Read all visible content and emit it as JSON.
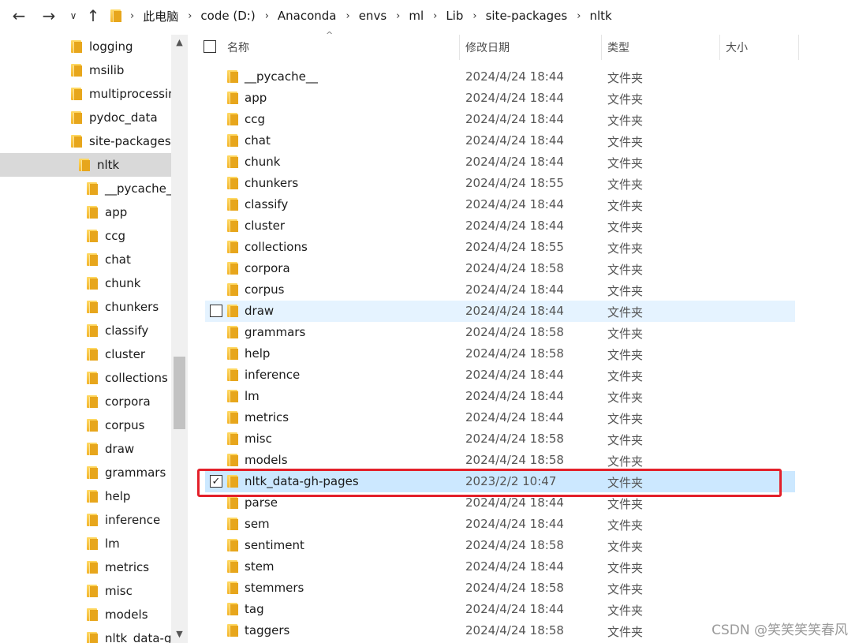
{
  "addressbar": {
    "path": [
      "此电脑",
      "code (D:)",
      "Anaconda",
      "envs",
      "ml",
      "Lib",
      "site-packages",
      "nltk"
    ]
  },
  "nav_tree": {
    "items": [
      {
        "label": "logging"
      },
      {
        "label": "msilib"
      },
      {
        "label": "multiprocessing"
      },
      {
        "label": "pydoc_data"
      },
      {
        "label": "site-packages"
      },
      {
        "label": "nltk"
      },
      {
        "label": "__pycache__"
      },
      {
        "label": "app"
      },
      {
        "label": "ccg"
      },
      {
        "label": "chat"
      },
      {
        "label": "chunk"
      },
      {
        "label": "chunkers"
      },
      {
        "label": "classify"
      },
      {
        "label": "cluster"
      },
      {
        "label": "collections"
      },
      {
        "label": "corpora"
      },
      {
        "label": "corpus"
      },
      {
        "label": "draw"
      },
      {
        "label": "grammars"
      },
      {
        "label": "help"
      },
      {
        "label": "inference"
      },
      {
        "label": "lm"
      },
      {
        "label": "metrics"
      },
      {
        "label": "misc"
      },
      {
        "label": "models"
      },
      {
        "label": "nltk_data-gh-pages"
      }
    ]
  },
  "columns": {
    "name": "名称",
    "date": "修改日期",
    "type": "类型",
    "size": "大小"
  },
  "files": [
    {
      "name": "__pycache__",
      "date": "2024/4/24 18:44",
      "type": "文件夹"
    },
    {
      "name": "app",
      "date": "2024/4/24 18:44",
      "type": "文件夹"
    },
    {
      "name": "ccg",
      "date": "2024/4/24 18:44",
      "type": "文件夹"
    },
    {
      "name": "chat",
      "date": "2024/4/24 18:44",
      "type": "文件夹"
    },
    {
      "name": "chunk",
      "date": "2024/4/24 18:44",
      "type": "文件夹"
    },
    {
      "name": "chunkers",
      "date": "2024/4/24 18:55",
      "type": "文件夹"
    },
    {
      "name": "classify",
      "date": "2024/4/24 18:44",
      "type": "文件夹"
    },
    {
      "name": "cluster",
      "date": "2024/4/24 18:44",
      "type": "文件夹"
    },
    {
      "name": "collections",
      "date": "2024/4/24 18:55",
      "type": "文件夹"
    },
    {
      "name": "corpora",
      "date": "2024/4/24 18:58",
      "type": "文件夹"
    },
    {
      "name": "corpus",
      "date": "2024/4/24 18:44",
      "type": "文件夹"
    },
    {
      "name": "draw",
      "date": "2024/4/24 18:44",
      "type": "文件夹"
    },
    {
      "name": "grammars",
      "date": "2024/4/24 18:58",
      "type": "文件夹"
    },
    {
      "name": "help",
      "date": "2024/4/24 18:58",
      "type": "文件夹"
    },
    {
      "name": "inference",
      "date": "2024/4/24 18:44",
      "type": "文件夹"
    },
    {
      "name": "lm",
      "date": "2024/4/24 18:44",
      "type": "文件夹"
    },
    {
      "name": "metrics",
      "date": "2024/4/24 18:44",
      "type": "文件夹"
    },
    {
      "name": "misc",
      "date": "2024/4/24 18:58",
      "type": "文件夹"
    },
    {
      "name": "models",
      "date": "2024/4/24 18:58",
      "type": "文件夹"
    },
    {
      "name": "nltk_data-gh-pages",
      "date": "2023/2/2 10:47",
      "type": "文件夹"
    },
    {
      "name": "parse",
      "date": "2024/4/24 18:44",
      "type": "文件夹"
    },
    {
      "name": "sem",
      "date": "2024/4/24 18:44",
      "type": "文件夹"
    },
    {
      "name": "sentiment",
      "date": "2024/4/24 18:58",
      "type": "文件夹"
    },
    {
      "name": "stem",
      "date": "2024/4/24 18:44",
      "type": "文件夹"
    },
    {
      "name": "stemmers",
      "date": "2024/4/24 18:58",
      "type": "文件夹"
    },
    {
      "name": "tag",
      "date": "2024/4/24 18:44",
      "type": "文件夹"
    },
    {
      "name": "taggers",
      "date": "2024/4/24 18:58",
      "type": "文件夹"
    }
  ],
  "watermark": "CSDN @笑笑笑笑春风",
  "icons": {
    "back": "back-arrow-icon",
    "forward": "forward-arrow-icon",
    "recent": "chevron-down-icon",
    "up": "up-arrow-icon",
    "folder": "folder-icon"
  },
  "colors": {
    "hover_row": "#e5f3ff",
    "selected_row": "#cce8ff",
    "highlight": "#e3202a",
    "tree_selected": "#d9d9d9"
  }
}
